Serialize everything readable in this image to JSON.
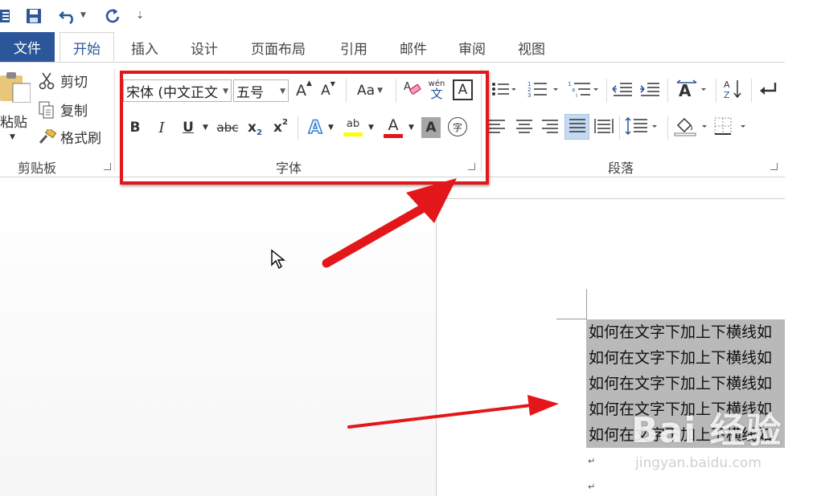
{
  "tabs": [
    {
      "id": "file",
      "label": "文件"
    },
    {
      "id": "home",
      "label": "开始"
    },
    {
      "id": "insert",
      "label": "插入"
    },
    {
      "id": "design",
      "label": "设计"
    },
    {
      "id": "layout",
      "label": "页面布局"
    },
    {
      "id": "references",
      "label": "引用"
    },
    {
      "id": "mailings",
      "label": "邮件"
    },
    {
      "id": "review",
      "label": "审阅"
    },
    {
      "id": "view",
      "label": "视图"
    }
  ],
  "clipboard": {
    "paste_label": "粘贴",
    "cut_label": "剪切",
    "copy_label": "复制",
    "format_painter_label": "格式刷",
    "group_label": "剪贴板"
  },
  "font": {
    "font_name": "宋体 (中文正文",
    "font_size": "五号",
    "grow_label": "A",
    "shrink_label": "A",
    "change_case_label": "Aa",
    "phonetic_top": "wén",
    "phonetic_bottom": "文",
    "border_label": "A",
    "bold": "B",
    "italic": "I",
    "underline": "U",
    "strike": "abc",
    "subscript": "x",
    "subscript_num": "2",
    "superscript": "x",
    "superscript_num": "2",
    "text_effect_label": "A",
    "highlight_label": "ab",
    "font_color_label": "A",
    "shading_label": "A",
    "enclose_label": "字",
    "group_label": "字体",
    "highlight_color": "#ffff00",
    "font_color": "#e3161a"
  },
  "paragraph": {
    "group_label": "段落"
  },
  "document": {
    "lines": [
      "如何在文字下加上下横线如",
      "如何在文字下加上下横线如",
      "如何在文字下加上下横线如",
      "如何在文字下加上下横线如",
      "如何在文字下加上下横线如"
    ],
    "paragraph_mark": "↵"
  },
  "watermark": {
    "brand": "Bai 经验",
    "url": "jingyan.baidu.com"
  },
  "colors": {
    "accent": "#2b579a",
    "annotation": "#e3161a",
    "selection": "#b9b9b9"
  }
}
